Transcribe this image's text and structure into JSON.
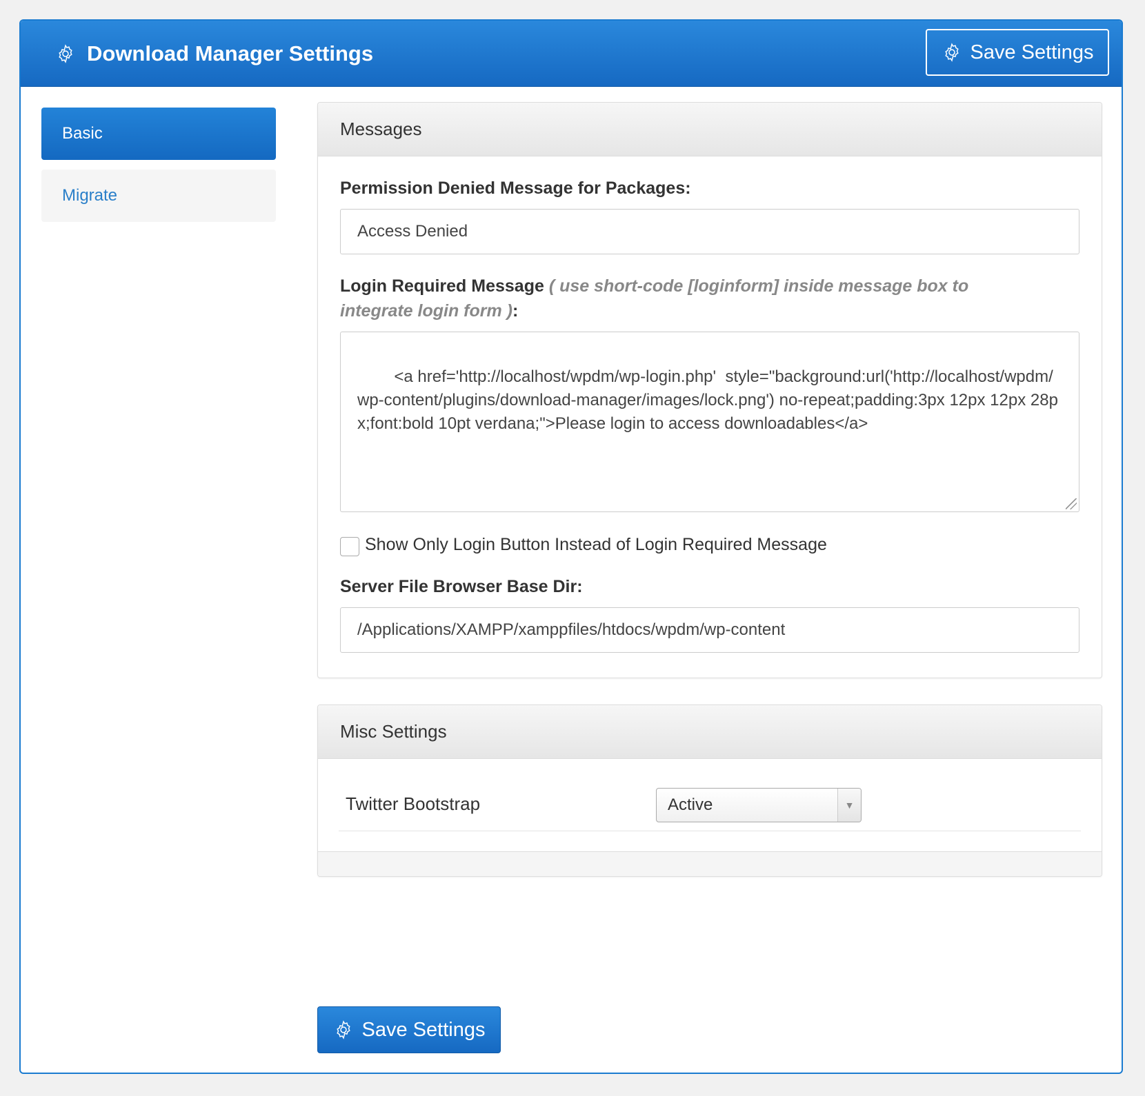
{
  "header": {
    "title": "Download Manager Settings",
    "title_icon": "gear-icon",
    "save_label": "Save Settings"
  },
  "nav": {
    "items": [
      {
        "label": "Basic",
        "active": true
      },
      {
        "label": "Migrate",
        "active": false
      }
    ]
  },
  "messages": {
    "heading": "Messages",
    "permission_label": "Permission Denied Message for Packages:",
    "permission_value": "Access Denied",
    "login_label": "Login Required Message",
    "login_hint": "( use short-code [loginform] inside message box to integrate login form )",
    "login_hint_suffix": ":",
    "login_value": "<a href='http://localhost/wpdm/wp-login.php'  style=\"background:url('http://localhost/wpdm/wp-content/plugins/download-manager/images/lock.png') no-repeat;padding:3px 12px 12px 28px;font:bold 10pt verdana;\">Please login to access downloadables</a>",
    "checkbox_label": "Show Only Login Button Instead of Login Required Message",
    "checkbox_checked": false,
    "basedir_label": "Server File Browser Base Dir:",
    "basedir_value": "/Applications/XAMPP/xamppfiles/htdocs/wpdm/wp-content"
  },
  "misc": {
    "heading": "Misc Settings",
    "bootstrap_label": "Twitter Bootstrap",
    "bootstrap_value": "Active"
  },
  "footer": {
    "save_label": "Save Settings"
  },
  "colors": {
    "primary": "#1a7bd0",
    "link": "#2a7fc9"
  }
}
